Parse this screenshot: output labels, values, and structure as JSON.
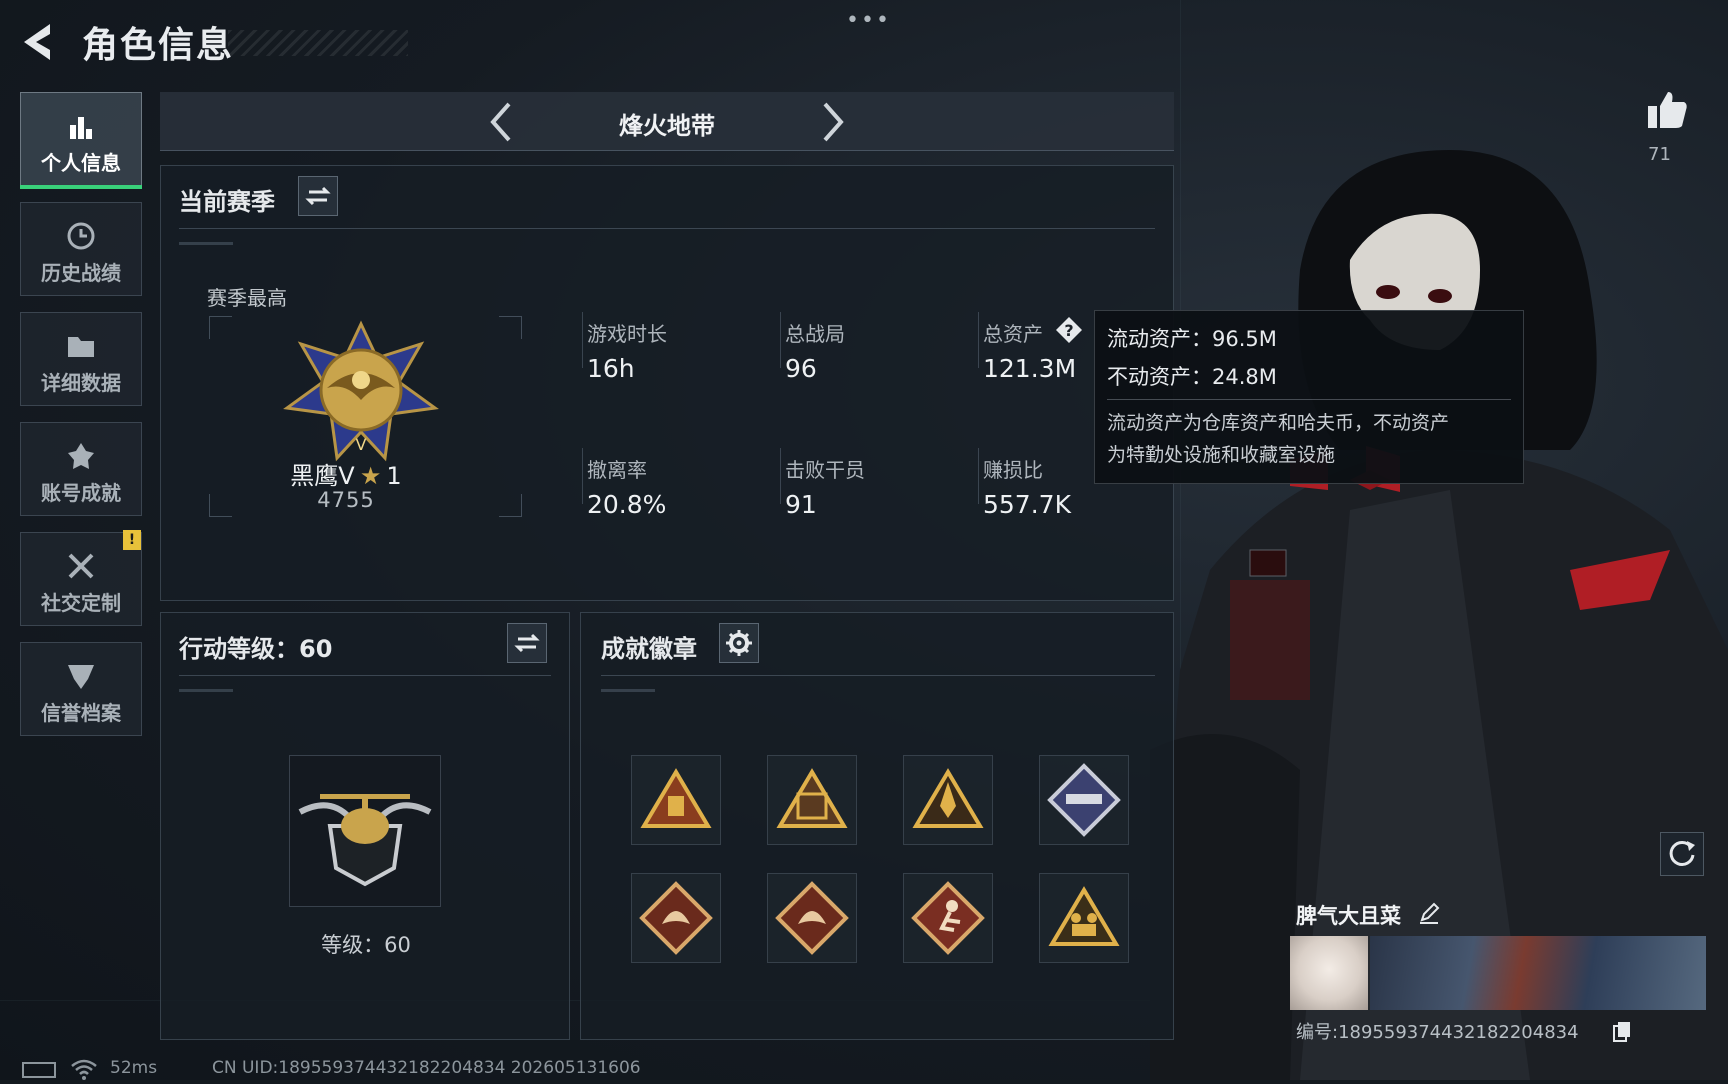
{
  "header": {
    "title": "角色信息"
  },
  "sidebar": {
    "items": [
      {
        "label": "个人信息",
        "icon": "bar-chart-icon",
        "active": true
      },
      {
        "label": "历史战绩",
        "icon": "history-clock-icon"
      },
      {
        "label": "详细数据",
        "icon": "folder-icon"
      },
      {
        "label": "账号成就",
        "icon": "achievement-icon"
      },
      {
        "label": "社交定制",
        "icon": "tools-icon",
        "alert": "!"
      },
      {
        "label": "信誉档案",
        "icon": "shield-icon"
      }
    ]
  },
  "mode": {
    "title": "烽火地带"
  },
  "season": {
    "title": "当前赛季",
    "best_label": "赛季最高",
    "rank_name": "黑鹰V",
    "rank_stars": "1",
    "rank_score": "4755",
    "stats": [
      {
        "label": "游戏时长",
        "value": "16h"
      },
      {
        "label": "总战局",
        "value": "96"
      },
      {
        "label": "总资产",
        "value": "121.3M"
      },
      {
        "label": "撤离率",
        "value": "20.8%"
      },
      {
        "label": "击败干员",
        "value": "91"
      },
      {
        "label": "赚损比",
        "value": "557.7K"
      }
    ],
    "help_icon": "?"
  },
  "tooltip": {
    "liquid": "流动资产：96.5M",
    "fixed": "不动资产：24.8M",
    "desc_line1": "流动资产为仓库资产和哈夫币，不动资产",
    "desc_line2": "为特勤处设施和收藏室设施"
  },
  "level": {
    "title": "行动等级：60",
    "caption": "等级：60"
  },
  "badges": {
    "title": "成就徽章",
    "items": [
      "warning-triangle-badge-icon",
      "crate-triangle-badge-icon",
      "rocket-triangle-badge-icon",
      "launcher-diamond-badge-icon",
      "dragon-diamond-badge-icon",
      "dragon-diamond-badge-icon",
      "runner-diamond-badge-icon",
      "soldiers-triangle-badge-icon"
    ]
  },
  "profile": {
    "likes": "71",
    "name": "脾气大且菜",
    "id": "编号:18955937443218220483​4"
  },
  "footer": {
    "ping": "52ms",
    "uid": "CN UID:18955937443218220483​4 202605131606"
  },
  "colors": {
    "accent_green": "#39d17a",
    "alert_yellow": "#e8c13a",
    "gold": "#c9a44c"
  }
}
